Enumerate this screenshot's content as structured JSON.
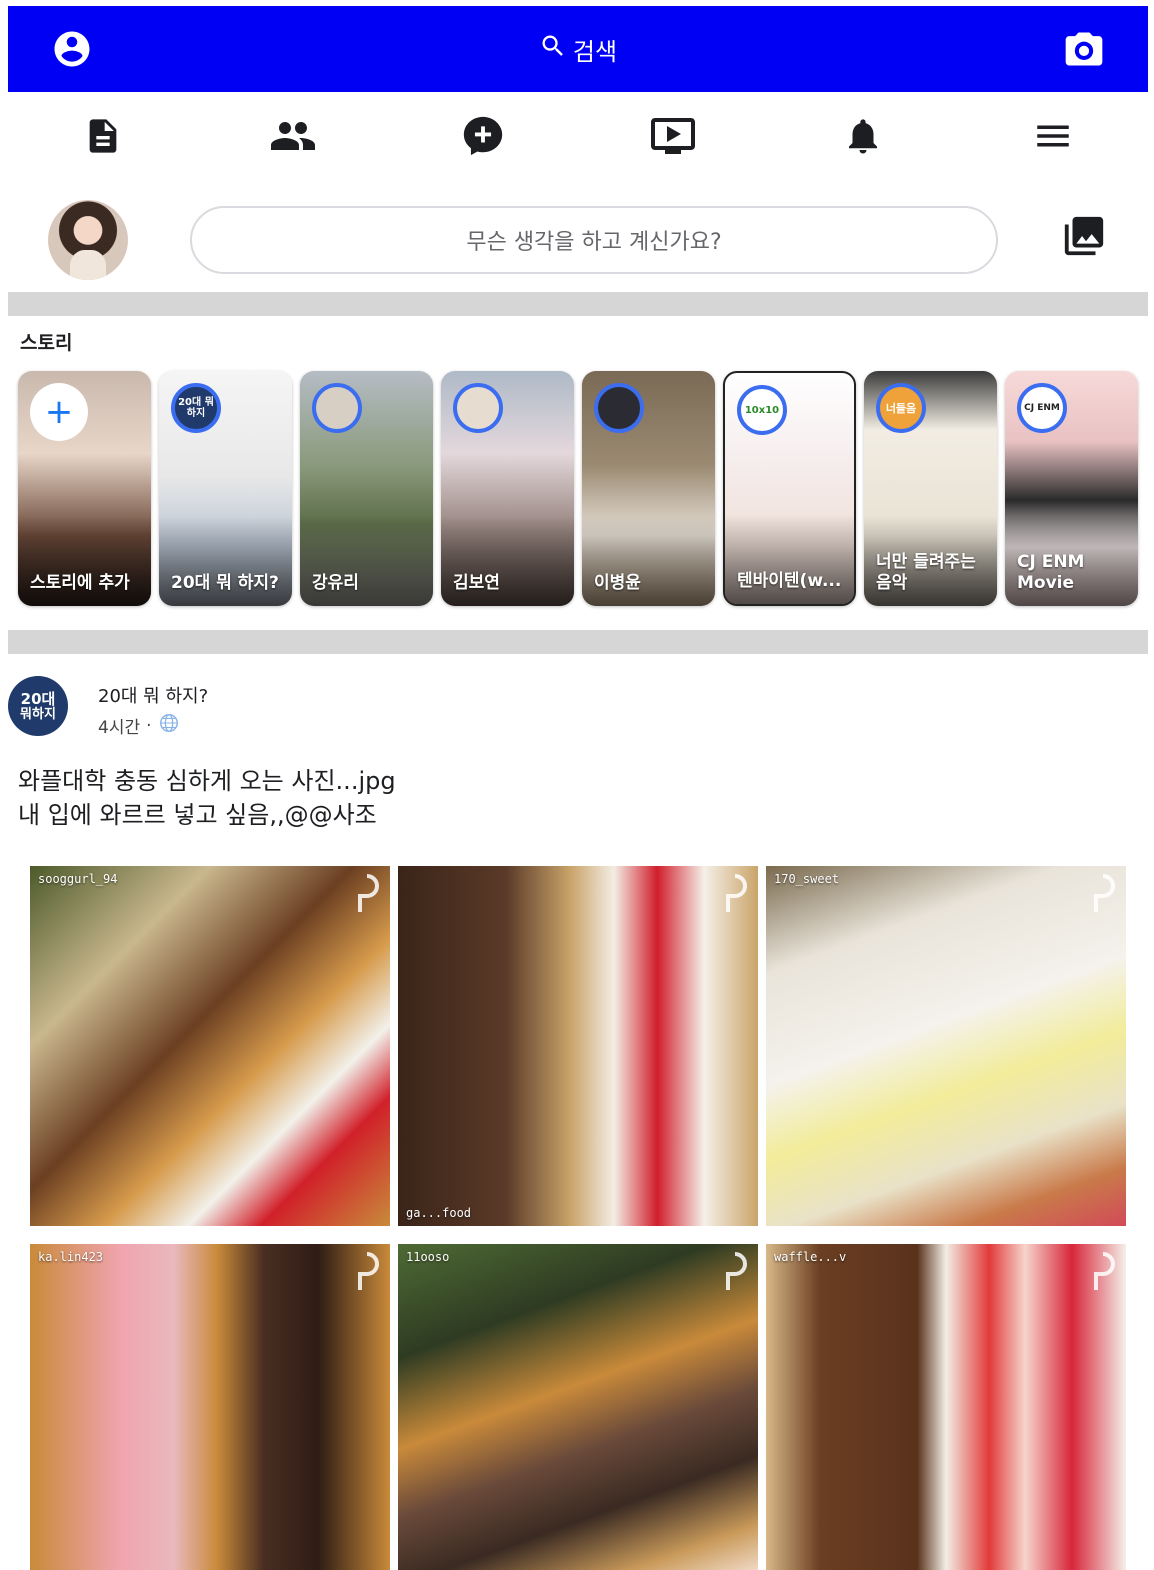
{
  "topbar": {
    "bg_color": "#0000f5",
    "profile_icon": "account-circle-icon",
    "search_label": "검색",
    "camera_icon": "camera-icon"
  },
  "nav": {
    "items": [
      "news-feed-icon",
      "friends-icon",
      "messenger-icon",
      "watch-icon",
      "notifications-icon",
      "menu-icon"
    ]
  },
  "composer": {
    "placeholder": "무슨 생각을 하고 계신가요?",
    "photo_icon": "photo-library-icon"
  },
  "stories": {
    "title": "스토리",
    "items": [
      {
        "label": "스토리에 추가"
      },
      {
        "label": "20대 뭐 하지?",
        "avatar_text": "20대 뭐하지"
      },
      {
        "label": "강유리"
      },
      {
        "label": "김보연"
      },
      {
        "label": "이병윤"
      },
      {
        "label": "텐바이텐(w..."
      },
      {
        "label": "너만 들려주는 음악",
        "avatar_text": "너들음"
      },
      {
        "label": "CJ ENM Movie",
        "avatar_text": "CJ ENM"
      }
    ]
  },
  "post": {
    "page_name": "20대 뭐 하지?",
    "avatar_text_top": "20대",
    "avatar_text_bottom": "뭐하지",
    "time": "4시간",
    "privacy_icon": "globe-icon",
    "text_line1": "와플대학 충동 심하게 오는 사진...jpg",
    "text_line2": "내 입에 와르르 넣고 싶음,,@@사조",
    "photos": [
      {
        "handle": "sooggurl_94"
      },
      {
        "handle": "ga...food"
      },
      {
        "handle": "170_sweet"
      },
      {
        "handle": "ka.lin423"
      },
      {
        "handle": "11ooso"
      },
      {
        "handle": "waffle...v"
      }
    ]
  }
}
